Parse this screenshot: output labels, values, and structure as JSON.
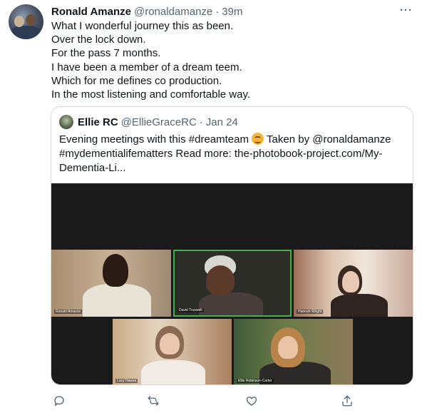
{
  "tweet": {
    "author_name": "Ronald Amanze",
    "author_handle": "@ronaldamanze",
    "separator": "·",
    "time": "39m",
    "more_icon": "more-horizontal-icon",
    "lines": [
      "What I wonderful journey this as been.",
      "Over the lock down.",
      "For the pass 7 months.",
      "I have been a member of a dream teem.",
      "Which for me defines co production.",
      "In the most listening and comfortable way."
    ]
  },
  "quoted": {
    "author_name": "Ellie RC",
    "author_handle": "@EllieGraceRC",
    "separator": "·",
    "time": "Jan 24",
    "text_line1_a": "Evening meetings with this #dreamteam",
    "emoji": "smiling-face-emoji",
    "text_line1_b": " Taken by @ronaldamanze",
    "text_line2": "#mydementialifematters Read more: the-photobook-project.com/My-",
    "text_line3": "Dementia-Li...",
    "participants": [
      "Ronald Amanze",
      "David Truswell",
      "Hannah Wright",
      "Lucy Hawes",
      "Ellie Robinson-Carter"
    ]
  },
  "actions": {
    "icons": [
      "reply-icon",
      "retweet-icon",
      "like-icon",
      "share-icon"
    ]
  },
  "colors": {
    "text_primary": "#0f1419",
    "text_secondary": "#536471",
    "border": "#cfd9de",
    "active_speaker": "#3fb24f"
  }
}
